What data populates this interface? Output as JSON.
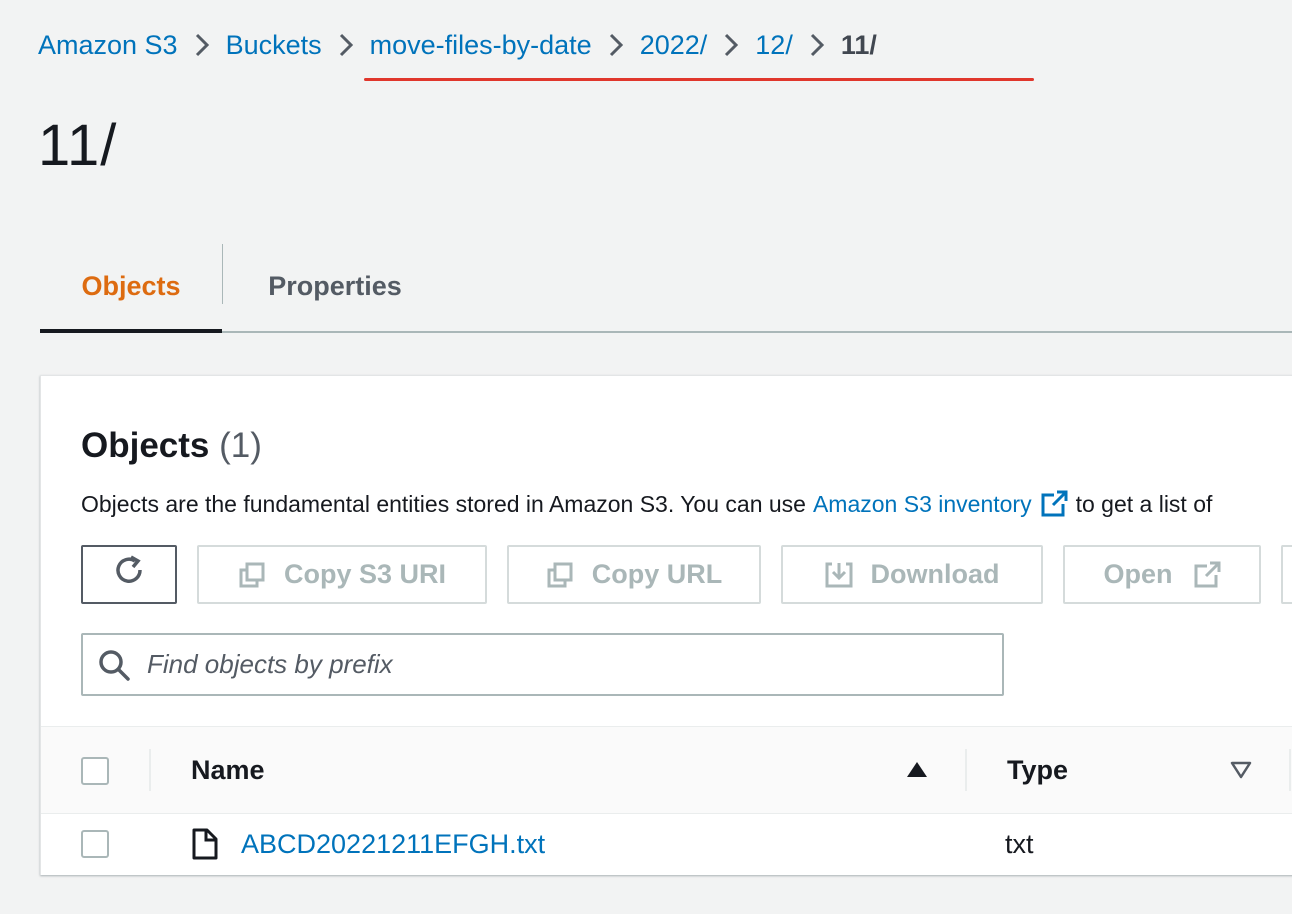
{
  "breadcrumb": {
    "items": [
      "Amazon S3",
      "Buckets",
      "move-files-by-date",
      "2022/",
      "12/"
    ],
    "current": "11/"
  },
  "page": {
    "title": "11/"
  },
  "tabs": [
    {
      "label": "Objects",
      "active": true
    },
    {
      "label": "Properties",
      "active": false
    }
  ],
  "objects_panel": {
    "title": "Objects",
    "count": "(1)",
    "description_before": "Objects are the fundamental entities stored in Amazon S3. You can use",
    "description_link": "Amazon S3 inventory",
    "description_after": "to get a list of"
  },
  "toolbar": {
    "refresh_icon": "refresh-icon",
    "copy_s3_uri": "Copy S3 URI",
    "copy_url": "Copy URL",
    "download": "Download",
    "open": "Open"
  },
  "search": {
    "placeholder": "Find objects by prefix",
    "value": ""
  },
  "table": {
    "columns": [
      "Name",
      "Type"
    ],
    "sort": {
      "column": "Name",
      "direction": "ascending"
    },
    "rows": [
      {
        "name": "ABCD20221211EFGH.txt",
        "type": "txt",
        "icon": "file-icon"
      }
    ]
  },
  "colors": {
    "link": "#0073bb",
    "active_tab": "#dd6b10",
    "annotation_underline": "#e0362b",
    "page_background": "#f2f3f3"
  }
}
